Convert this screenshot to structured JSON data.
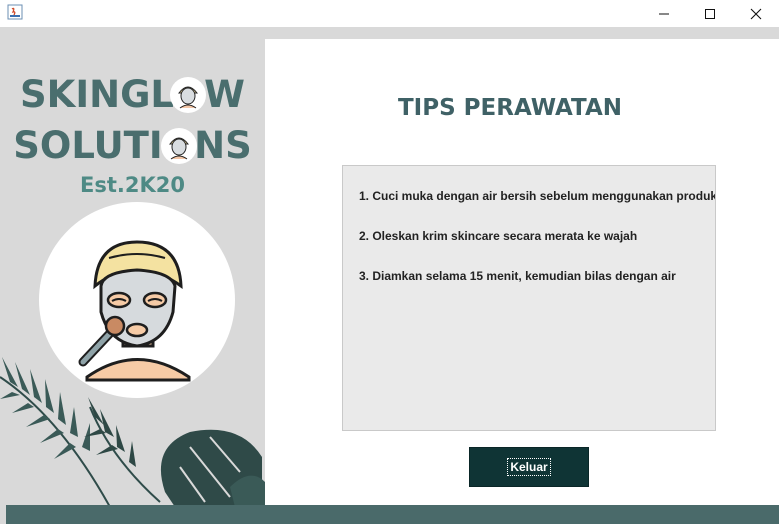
{
  "window": {
    "minimize_glyph": "—",
    "maximize_glyph": "☐",
    "close_glyph": "✕"
  },
  "brand": {
    "line1": "SKINGLOW",
    "line2": "SOLUTIONS",
    "est": "Est.2K20",
    "logo_icon": "face-mask-icon"
  },
  "content": {
    "heading": "TIPS PERAWATAN",
    "tips": [
      "1. Cuci muka dengan air bersih sebelum menggunakan produk",
      "2. Oleskan krim skincare secara merata ke wajah",
      "3. Diamkan selama 15 menit, kemudian bilas dengan air"
    ],
    "exit_button": "Keluar"
  },
  "colors": {
    "brand": "#4a6e6e",
    "button_bg": "#0f3435",
    "sidebar_bg": "#d9d9d9"
  }
}
